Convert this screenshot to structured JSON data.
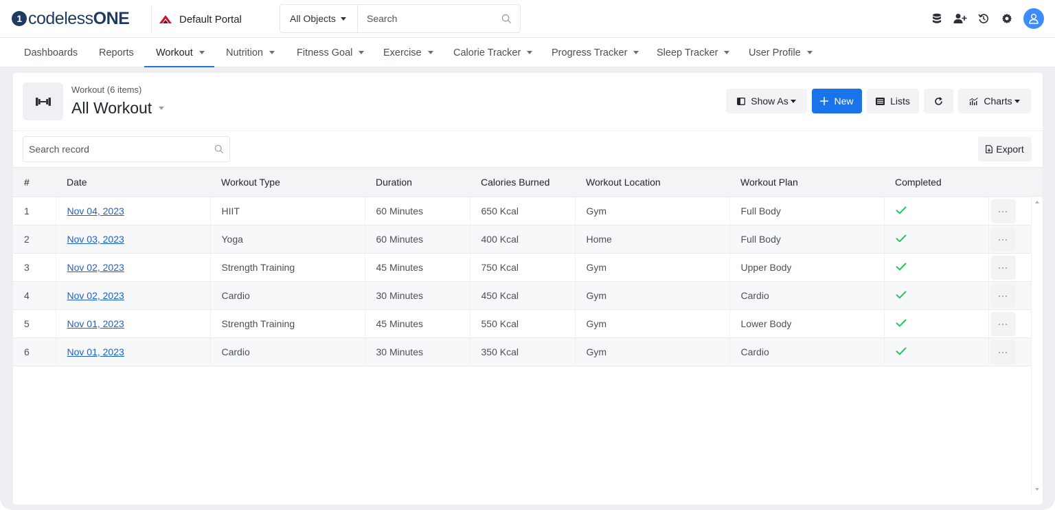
{
  "app": {
    "logo_mark": "1",
    "logo_text_light": "codeless",
    "logo_text_bold": "ONE",
    "portal_name": "Default Portal"
  },
  "search": {
    "object_select": "All Objects",
    "placeholder": "Search"
  },
  "nav": {
    "items": [
      {
        "label": "Dashboards"
      },
      {
        "label": "Reports"
      },
      {
        "label": "Workout"
      },
      {
        "label": "Nutrition"
      },
      {
        "label": "Fitness Goal"
      },
      {
        "label": "Exercise"
      },
      {
        "label": "Calorie Tracker"
      },
      {
        "label": "Progress Tracker"
      },
      {
        "label": "Sleep Tracker"
      },
      {
        "label": "User Profile"
      }
    ]
  },
  "header": {
    "subtitle": "Workout (6 items)",
    "title": "All Workout",
    "show_as_label": "Show As",
    "new_label": "New",
    "lists_label": "Lists",
    "charts_label": "Charts"
  },
  "records": {
    "search_placeholder": "Search record",
    "export_label": "Export"
  },
  "table": {
    "columns": [
      "#",
      "Date",
      "Workout Type",
      "Duration",
      "Calories Burned",
      "Workout Location",
      "Workout Plan",
      "Completed"
    ],
    "rows": [
      {
        "num": "1",
        "date": "Nov 04, 2023",
        "type": "HIIT",
        "duration": "60 Minutes",
        "calories": "650 Kcal",
        "location": "Gym",
        "plan": "Full Body",
        "completed": true,
        "more": "···"
      },
      {
        "num": "2",
        "date": "Nov 03, 2023",
        "type": "Yoga",
        "duration": "60 Minutes",
        "calories": "400 Kcal",
        "location": "Home",
        "plan": "Full Body",
        "completed": true,
        "more": "···"
      },
      {
        "num": "3",
        "date": "Nov 02, 2023",
        "type": "Strength Training",
        "duration": "45 Minutes",
        "calories": "750 Kcal",
        "location": "Gym",
        "plan": "Upper Body",
        "completed": true,
        "more": "···"
      },
      {
        "num": "4",
        "date": "Nov 02, 2023",
        "type": "Cardio",
        "duration": "30 Minutes",
        "calories": "450 Kcal",
        "location": "Gym",
        "plan": "Cardio",
        "completed": true,
        "more": "···"
      },
      {
        "num": "5",
        "date": "Nov 01, 2023",
        "type": "Strength Training",
        "duration": "45 Minutes",
        "calories": "550 Kcal",
        "location": "Gym",
        "plan": "Lower Body",
        "completed": true,
        "more": "···"
      },
      {
        "num": "6",
        "date": "Nov 01, 2023",
        "type": "Cardio",
        "duration": "30 Minutes",
        "calories": "350 Kcal",
        "location": "Gym",
        "plan": "Cardio",
        "completed": true,
        "more": "···"
      }
    ]
  },
  "colors": {
    "accent": "#1a73e8",
    "check": "#22c55e",
    "brand": "#1f3a5f",
    "portal_icon": "#c8102e"
  },
  "icons": {
    "object": "dumbbell-icon",
    "search": "search-icon",
    "database": "database-icon",
    "add_user": "add-user-icon",
    "history": "history-icon",
    "settings": "gear-icon",
    "user": "user-icon",
    "completed": "check-icon"
  }
}
